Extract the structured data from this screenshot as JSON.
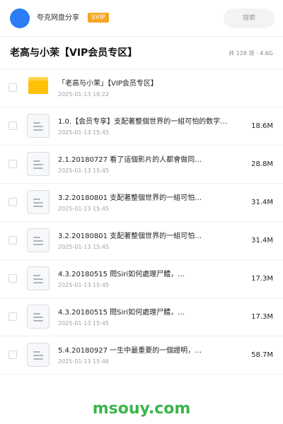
{
  "header": {
    "username": "夸克网盘分享",
    "badge": "SVIP",
    "search_placeholder": "搜索"
  },
  "title_row": {
    "title": "老高与小茉【VIP会员专区】",
    "meta": "共 128 项 · 4.6G"
  },
  "files": [
    {
      "type": "folder",
      "name": "「老高与小茉」【VIP会员专区】",
      "date": "2025-01-13 18:22",
      "size": ""
    },
    {
      "type": "file",
      "name": "1.0.【会员专享】支配著整個世界的一組可怕的数字…",
      "date": "2025-01-13 15:45",
      "size": "18.6M"
    },
    {
      "type": "file",
      "name": "2.1.20180727 看了這個影片的人都會做同…",
      "date": "2025-01-13 15:45",
      "size": "28.8M"
    },
    {
      "type": "file",
      "name": "3.2.20180801 支配著整個世界的一組可怕…",
      "date": "2025-01-13 15:45",
      "size": "31.4M"
    },
    {
      "type": "file",
      "name": "3.2.20180801 支配著整個世界的一組可怕…",
      "date": "2025-01-13 15:45",
      "size": "31.4M"
    },
    {
      "type": "file",
      "name": "4.3.20180515 問Siri如何處理尸體，…",
      "date": "2025-01-13 15:45",
      "size": "17.3M"
    },
    {
      "type": "file",
      "name": "4.3.20180515 問Siri如何處理尸體，…",
      "date": "2025-01-13 15:45",
      "size": "17.3M"
    },
    {
      "type": "file",
      "name": "5.4.20180927 一生中最重要的一個證明，…",
      "date": "2025-01-13 15:46",
      "size": "58.7M"
    }
  ],
  "watermark": "msouy.com",
  "colors": {
    "accent": "#2b7cf6",
    "badge": "#f5a623",
    "folder": "#ffc107",
    "watermark": "#3ab54a"
  }
}
